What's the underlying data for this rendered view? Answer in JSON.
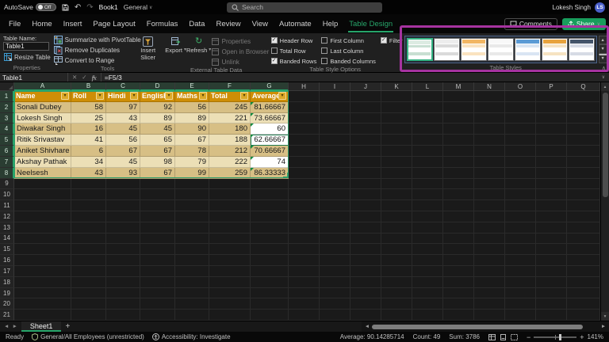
{
  "titlebar": {
    "autosave_label": "AutoSave",
    "autosave_state": "Off",
    "workbook_name": "Book1",
    "sensitivity_label": "General",
    "search_placeholder": "Search",
    "user_name": "Lokesh Singh",
    "user_initials": "LS"
  },
  "menubar": {
    "tabs": [
      "File",
      "Home",
      "Insert",
      "Page Layout",
      "Formulas",
      "Data",
      "Review",
      "View",
      "Automate",
      "Help",
      "Table Design"
    ],
    "active_tab": "Table Design",
    "comments_label": "Comments",
    "share_label": "Share"
  },
  "ribbon": {
    "properties_group": {
      "label": "Properties",
      "table_name_label": "Table Name:",
      "table_name_value": "Table1",
      "resize_table_label": "Resize Table"
    },
    "tools_group": {
      "label": "Tools",
      "buttons": [
        "Summarize with PivotTable",
        "Remove Duplicates",
        "Convert to Range"
      ],
      "insert_slicer_line1": "Insert",
      "insert_slicer_line2": "Slicer"
    },
    "external_group": {
      "label": "External Table Data",
      "export_label": "Export",
      "refresh_label": "Refresh",
      "disabled_buttons": [
        "Properties",
        "Open in Browser",
        "Unlink"
      ]
    },
    "style_options_group": {
      "label": "Table Style Options",
      "columns": [
        [
          {
            "label": "Header Row",
            "checked": true
          },
          {
            "label": "Total Row",
            "checked": false
          },
          {
            "label": "Banded Rows",
            "checked": true
          }
        ],
        [
          {
            "label": "First Column",
            "checked": false
          },
          {
            "label": "Last Column",
            "checked": false
          },
          {
            "label": "Banded Columns",
            "checked": false
          }
        ],
        [
          {
            "label": "Filter Button",
            "checked": true
          }
        ]
      ]
    },
    "table_styles_group": {
      "label": "Table Styles",
      "styles": [
        {
          "name": "light-green",
          "header": "#dcebe2",
          "band": "#c8dfd2",
          "selected": true
        },
        {
          "name": "light-gray",
          "header": "#ededed",
          "band": "#dadada",
          "selected": false
        },
        {
          "name": "light-orange",
          "header": "#f2b663",
          "band": "#fae3c0",
          "selected": false
        },
        {
          "name": "light-white",
          "header": "#f8f8f8",
          "band": "#e9e9e9",
          "selected": false
        },
        {
          "name": "medium-blue",
          "header": "#5b9bd5",
          "band": "#d9e5f3",
          "selected": false
        },
        {
          "name": "medium-gold",
          "header": "#e8a33d",
          "band": "#f6e3c2",
          "selected": false
        },
        {
          "name": "medium-navy",
          "header": "#44546a",
          "band": "#d6dbe5",
          "selected": false
        }
      ]
    }
  },
  "formula_bar": {
    "name_box": "Table1",
    "formula": "=F5/3"
  },
  "sheet": {
    "columns": [
      "A",
      "B",
      "C",
      "D",
      "E",
      "F",
      "G",
      "H",
      "I",
      "J",
      "K",
      "L",
      "M",
      "N",
      "O",
      "P",
      "Q"
    ],
    "visible_rows": 21,
    "selected_columns": [
      "A",
      "B",
      "C",
      "D",
      "E",
      "F",
      "G"
    ],
    "selected_rows": [
      1,
      2,
      3,
      4,
      5,
      6,
      7,
      8
    ],
    "active_cell": "G5"
  },
  "table": {
    "headers": [
      "Name",
      "Roll",
      "Hindi",
      "English",
      "Maths",
      "Total",
      "Average"
    ],
    "rows": [
      [
        "Sonali Dubey",
        "58",
        "97",
        "92",
        "56",
        "245",
        "81.66667"
      ],
      [
        "Lokesh Singh",
        "25",
        "43",
        "89",
        "89",
        "221",
        "73.66667"
      ],
      [
        "Diwakar Singh",
        "16",
        "45",
        "45",
        "90",
        "180",
        "60"
      ],
      [
        "Ritik Srivastav",
        "41",
        "56",
        "65",
        "67",
        "188",
        "62.66667"
      ],
      [
        "Aniket Shivhare",
        "6",
        "67",
        "67",
        "78",
        "212",
        "70.66667"
      ],
      [
        "Akshay Pathak",
        "34",
        "45",
        "98",
        "79",
        "222",
        "74"
      ],
      [
        "Neelsesh",
        "43",
        "93",
        "67",
        "99",
        "259",
        "86.33333"
      ]
    ],
    "white_cells": [
      "G4",
      "G5",
      "G7"
    ],
    "error_mark_cells": [
      "G2",
      "G3",
      "G4",
      "G5",
      "G6",
      "G7",
      "G8"
    ]
  },
  "sheet_tabs": {
    "active_tab": "Sheet1",
    "add_label": "+"
  },
  "status_bar": {
    "mode": "Ready",
    "sensitivity": "General/All Employees (unrestricted)",
    "accessibility": "Accessibility: Investigate",
    "average": "Average: 90.14285714",
    "count": "Count: 49",
    "sum": "Sum: 3786",
    "zoom": "141%"
  },
  "colors": {
    "accent_green": "#27a56a",
    "table_header_fill": "#ce8e06",
    "band_dark": "#d7bf85",
    "band_light": "#ecdfb6",
    "annotation_purple": "#a633a0",
    "avatar_blue": "#4a5fc9",
    "share_green": "#189d5c"
  }
}
